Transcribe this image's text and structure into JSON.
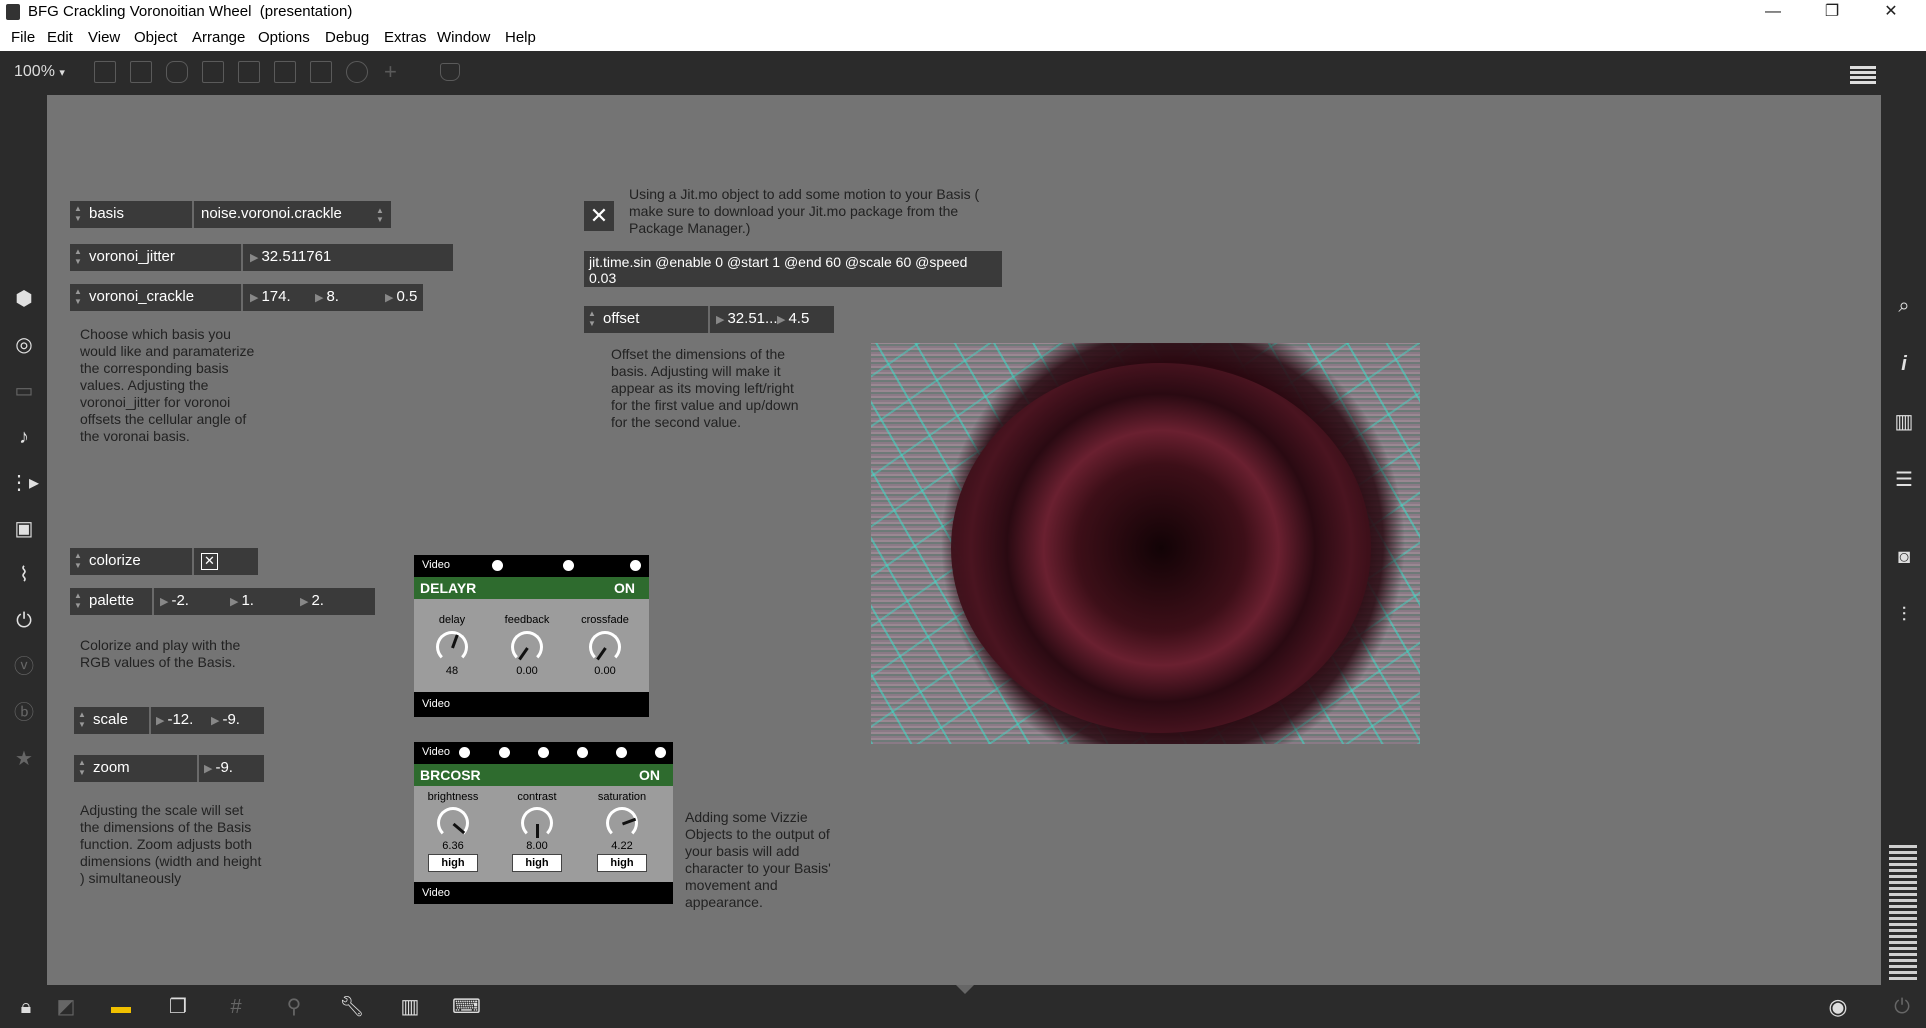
{
  "window": {
    "title": "BFG Crackling Voronoitian Wheel  (presentation)",
    "controls": [
      "—",
      "❐",
      "✕"
    ]
  },
  "menu": [
    "File",
    "Edit",
    "View",
    "Object",
    "Arrange",
    "Options",
    "Debug",
    "Extras",
    "Window",
    "Help"
  ],
  "toolbar": {
    "zoom": "100%",
    "zoom_caret": "▾"
  },
  "patch": {
    "basis": {
      "name": "basis",
      "value": "noise.voronoi.crackle"
    },
    "voronoi_jitter": {
      "name": "voronoi_jitter",
      "value": "32.511761"
    },
    "voronoi_crackle": {
      "name": "voronoi_crackle",
      "values": [
        "174.",
        "8.",
        "0.5"
      ]
    },
    "comment_basis": "Choose which basis you would like and paramaterize the corresponding basis values. Adjusting the voronoi_jitter for voronoi offsets the cellular angle of the voronai basis.",
    "colorize": {
      "name": "colorize",
      "checked": true,
      "mark": "✕"
    },
    "palette": {
      "name": "palette",
      "values": [
        "-2.",
        "1.",
        "2."
      ]
    },
    "comment_colorize": "Colorize and play with the RGB values of the Basis.",
    "scale": {
      "name": "scale",
      "values": [
        "-12.",
        "-9."
      ]
    },
    "zoom": {
      "name": "zoom",
      "values": [
        "-9."
      ]
    },
    "comment_scale": "Adjusting the scale will set the dimensions of the Basis function. Zoom adjusts both dimensions (width and height ) simultaneously",
    "toggle_mark": "✕",
    "comment_jitmo": "Using a Jit.mo object to add some motion to your Basis ( make sure to download your Jit.mo package from the Package Manager.)",
    "message": "jit.time.sin @enable 0 @start 1 @end 60 @scale 60 @speed 0.03",
    "offset": {
      "name": "offset",
      "values": [
        "32.51...",
        "4.5"
      ]
    },
    "comment_offset": "Offset the dimensions of the basis. Adjusting will make it appear as its moving left/right for the first value and up/down for the second value.",
    "comment_vizzie": "Adding some Vizzie Objects to the output of your basis will add character to your Basis' movement and appearance."
  },
  "delayr": {
    "in_label": "Video",
    "title": "DELAYR",
    "state": "ON",
    "knobs": [
      {
        "label": "delay",
        "value": "48",
        "level": 0.4
      },
      {
        "label": "feedback",
        "value": "0.00",
        "level": 0.0
      },
      {
        "label": "crossfade",
        "value": "0.00",
        "level": 0.0
      }
    ],
    "out_label": "Video"
  },
  "brcosr": {
    "in_label": "Video",
    "title": "BRCOSR",
    "state": "ON",
    "knobs": [
      {
        "label": "brightness",
        "value": "6.36",
        "level": 0.62,
        "mode": "high"
      },
      {
        "label": "contrast",
        "value": "8.00",
        "level": 0.5,
        "mode": "high"
      },
      {
        "label": "saturation",
        "value": "4.22",
        "level": 0.8,
        "mode": "high"
      }
    ],
    "out_label": "Video"
  },
  "sidebar_left": [
    "cube-icon",
    "target-icon",
    "film-icon",
    "music-note-icon",
    "sequence-icon",
    "image-icon",
    "paperclip-icon",
    "plug-icon",
    "vimeo-icon",
    "bandcamp-icon",
    "star-icon"
  ],
  "sidebar_right": [
    "search-icon",
    "info-icon",
    "book-icon",
    "list-icon",
    "camera-icon",
    "sliders-icon"
  ]
}
